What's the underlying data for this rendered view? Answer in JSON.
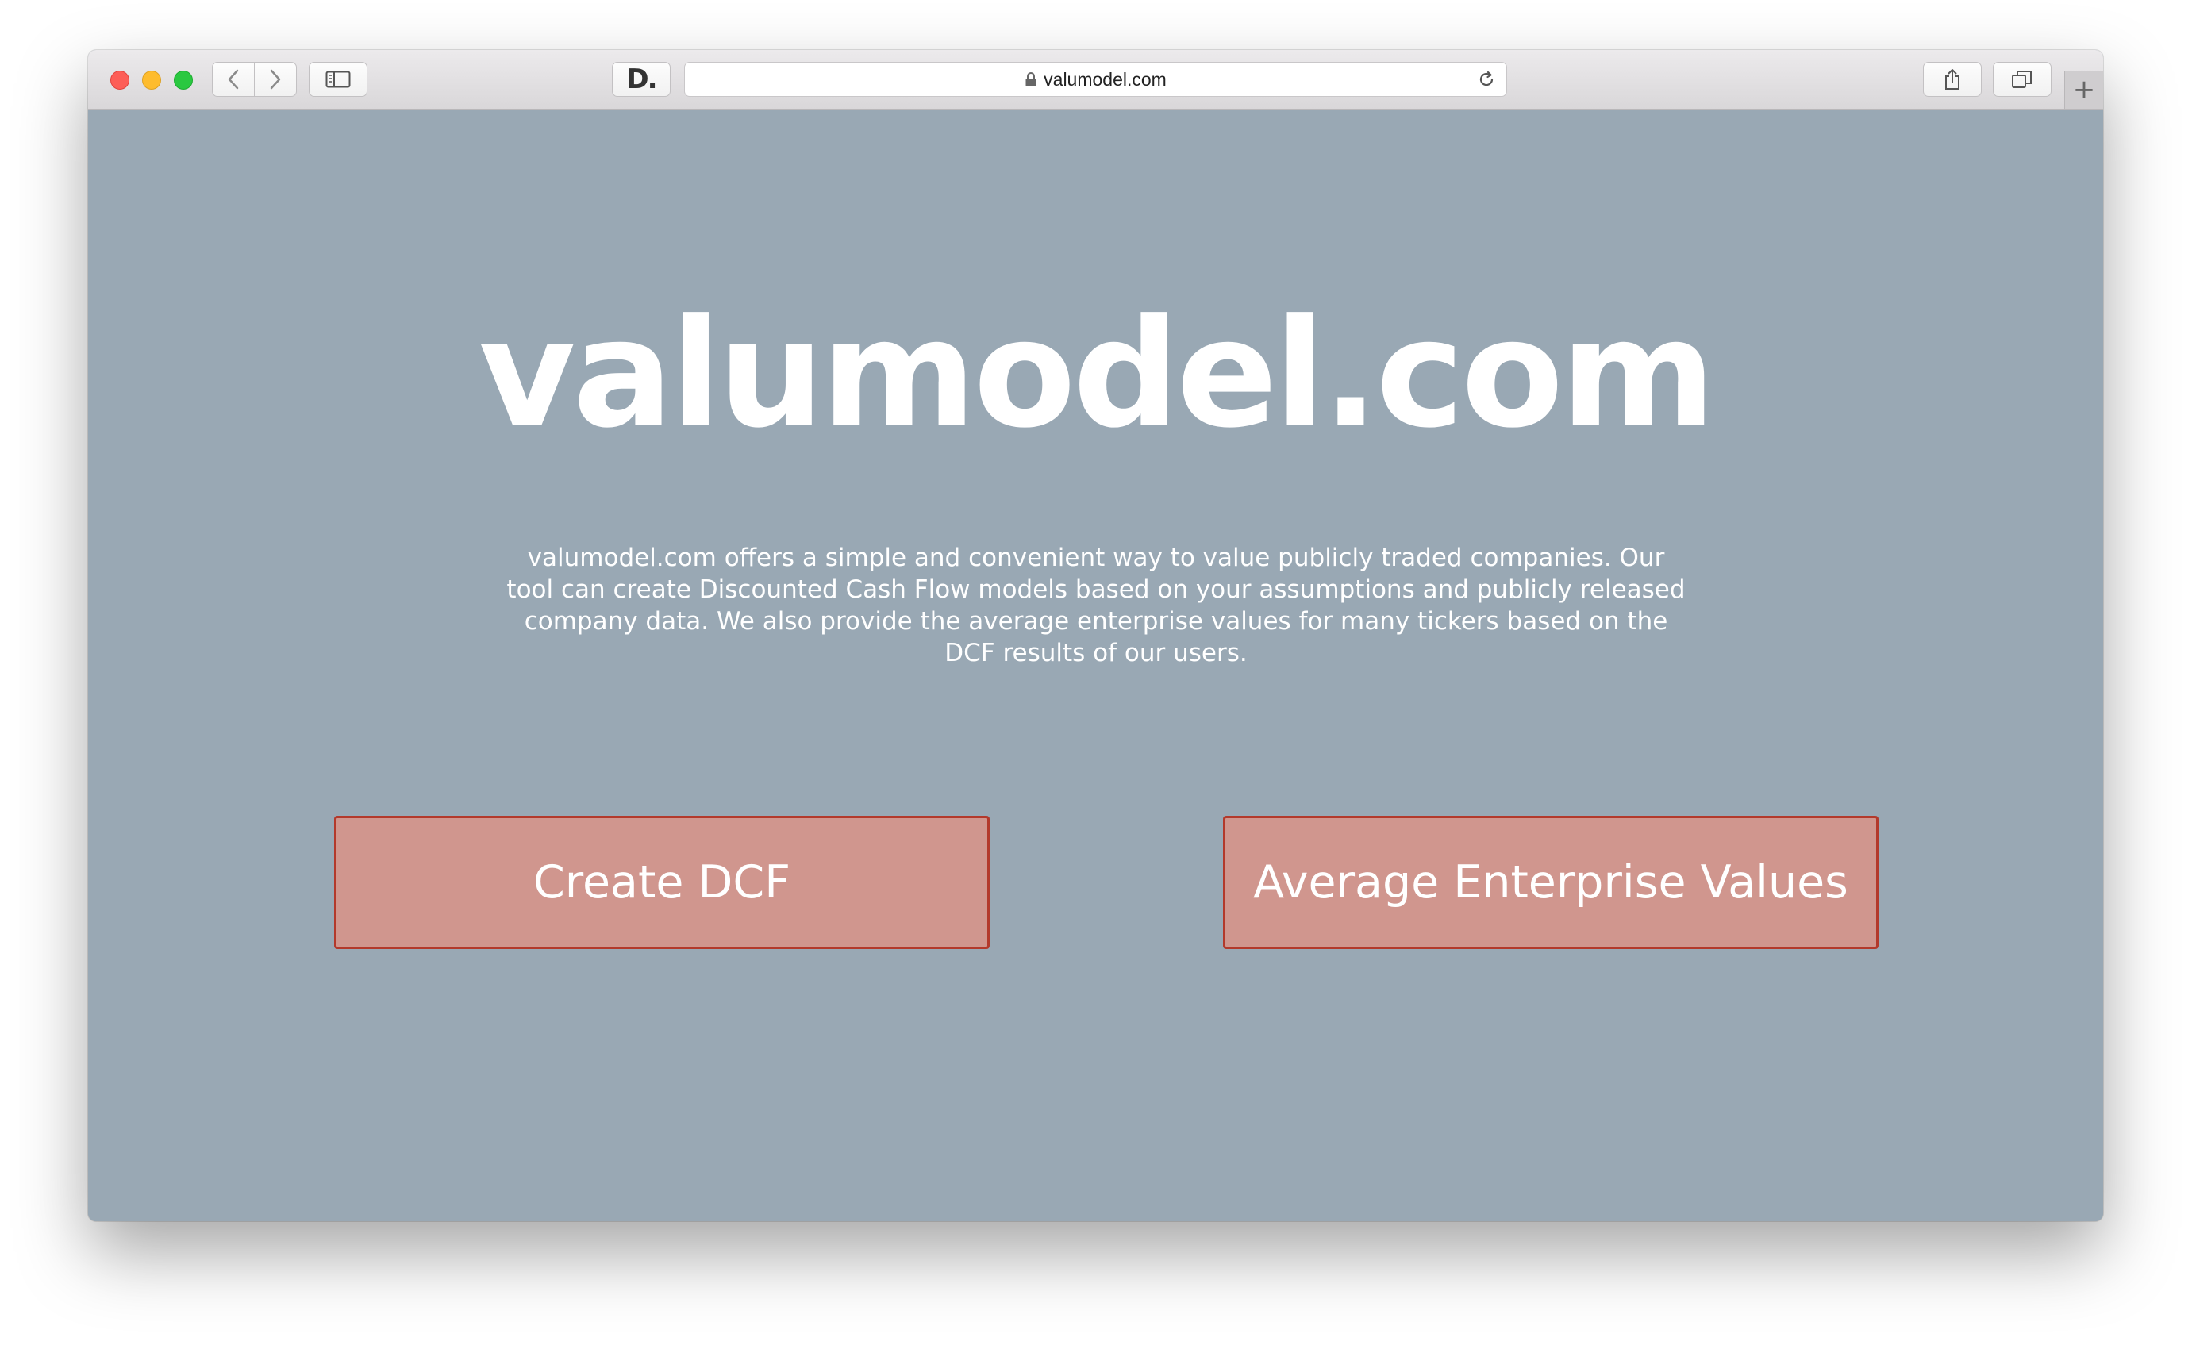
{
  "browser": {
    "url": "valumodel.com",
    "new_tab_label": "+",
    "extension_logo": "D.",
    "icons": {
      "back": "chevron-left-icon",
      "forward": "chevron-right-icon",
      "sidebar": "sidebar-icon",
      "lock": "lock-icon",
      "reload": "reload-icon",
      "share": "share-icon",
      "tabs": "tabs-overview-icon"
    }
  },
  "hero": {
    "title": "valumodel.com",
    "description": "valumodel.com offers a simple and convenient way to value publicly traded companies. Our tool can create Discounted Cash Flow models based on your assumptions and publicly released company data. We also provide the average enterprise values for many tickers based on the DCF results of our users."
  },
  "actions": {
    "create_dcf": "Create DCF",
    "average_ev": "Average Enterprise Values"
  },
  "colors": {
    "page_background": "#99a8b4",
    "button_fill": "#d0968e",
    "button_border": "#b3392b",
    "text": "#ffffff"
  }
}
